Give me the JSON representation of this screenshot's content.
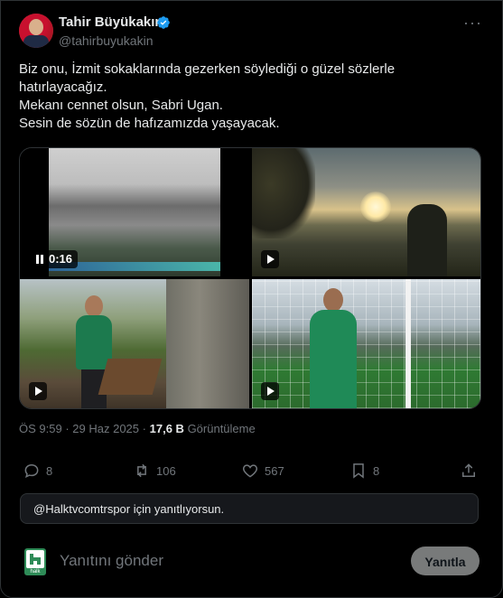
{
  "author": {
    "name": "Tahir Büyükakın",
    "handle": "@tahirbuyukakin",
    "verified": true
  },
  "tweet": {
    "lines": [
      "Biz onu, İzmit sokaklarında gezerken söylediği o güzel sözlerle",
      "hatırlayacağız.",
      "Mekanı cennet olsun, Sabri Ugan.",
      "Sesin de sözün de hafızamızda yaşayacak."
    ]
  },
  "media": {
    "video_duration": "0:16"
  },
  "meta": {
    "time": "ÖS 9:59",
    "separator": "·",
    "date": "29 Haz 2025",
    "views": "17,6 B",
    "views_label": "Görüntüleme"
  },
  "actions": {
    "replies": "8",
    "reposts": "106",
    "likes": "567",
    "bookmarks": "8"
  },
  "reply_banner": {
    "text": "@Halktvcomtrspor için yanıtlıyorsun."
  },
  "compose": {
    "placeholder": "Yanıtını gönder",
    "button_label": "Yanıtla",
    "avatar_text": "halk"
  },
  "colors": {
    "background": "#000000",
    "text": "#e7e9ea",
    "muted": "#71767b",
    "verified": "#1d9bf0",
    "border": "#2f3336"
  }
}
